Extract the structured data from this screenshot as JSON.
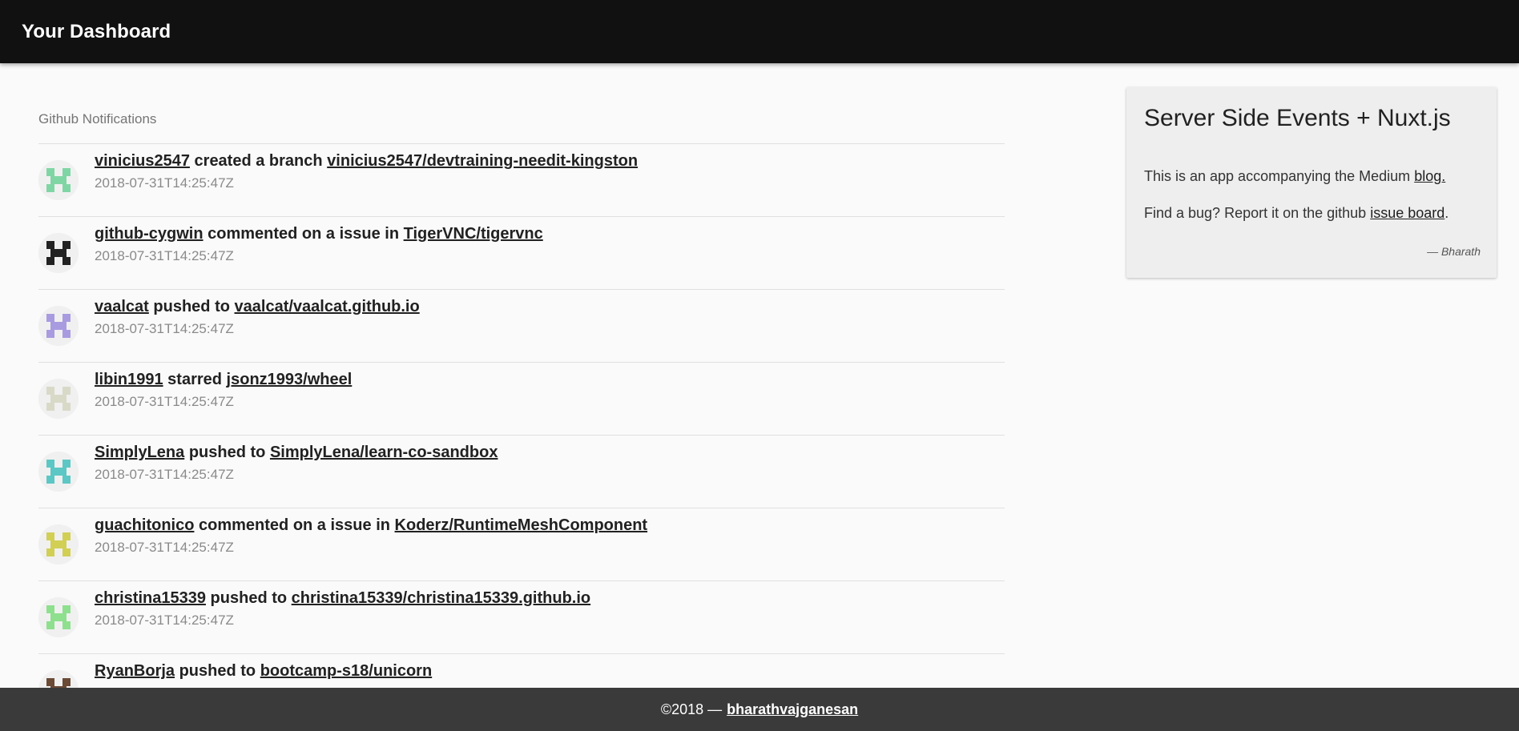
{
  "header": {
    "title": "Your Dashboard"
  },
  "feed": {
    "title": "Github Notifications",
    "items": [
      {
        "user": "vinicius2547",
        "verb": "created a branch",
        "repo": "vinicius2547/devtraining-needit-kingston",
        "time": "2018-07-31T14:25:47Z",
        "avatar_color": "#7fd6a4"
      },
      {
        "user": "github-cygwin",
        "verb": "commented on a issue in",
        "repo": "TigerVNC/tigervnc",
        "time": "2018-07-31T14:25:47Z",
        "avatar_color": "#222222"
      },
      {
        "user": "vaalcat",
        "verb": "pushed to",
        "repo": "vaalcat/vaalcat.github.io",
        "time": "2018-07-31T14:25:47Z",
        "avatar_color": "#a99be0"
      },
      {
        "user": "libin1991",
        "verb": "starred",
        "repo": "jsonz1993/wheel",
        "time": "2018-07-31T14:25:47Z",
        "avatar_color": "#d9d9c8"
      },
      {
        "user": "SimplyLena",
        "verb": "pushed to",
        "repo": "SimplyLena/learn-co-sandbox",
        "time": "2018-07-31T14:25:47Z",
        "avatar_color": "#5cc7c4"
      },
      {
        "user": "guachitonico",
        "verb": "commented on a issue in",
        "repo": "Koderz/RuntimeMeshComponent",
        "time": "2018-07-31T14:25:47Z",
        "avatar_color": "#d2cf55"
      },
      {
        "user": "christina15339",
        "verb": "pushed to",
        "repo": "christina15339/christina15339.github.io",
        "time": "2018-07-31T14:25:47Z",
        "avatar_color": "#8ee08e"
      },
      {
        "user": "RyanBorja",
        "verb": "pushed to",
        "repo": "bootcamp-s18/unicorn",
        "time": "",
        "avatar_color": "#6b4a36"
      }
    ]
  },
  "card": {
    "title": "Server Side Events + Nuxt.js",
    "p1_text": "This is an app accompanying the Medium",
    "p1_link": "blog.",
    "p2_text": "Find a bug? Report it on the github",
    "p2_link": "issue board",
    "p2_tail": ".",
    "signature": "— Bharath"
  },
  "footer": {
    "text": "©2018 —",
    "link": "bharathvajganesan"
  }
}
